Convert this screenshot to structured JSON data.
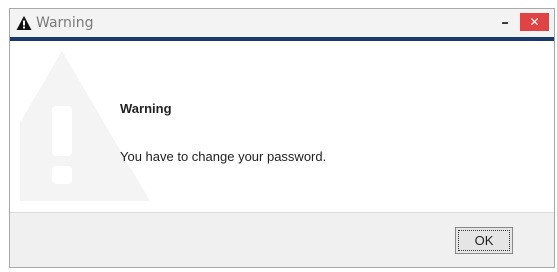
{
  "window": {
    "title": "Warning",
    "minimize_label": "–",
    "close_label": "✕"
  },
  "dialog": {
    "heading": "Warning",
    "message": "You have to change your password.",
    "icon": "warning-icon"
  },
  "footer": {
    "ok_label": "OK"
  },
  "colors": {
    "accent_bar": "#1a3a6b",
    "close_button": "#e04343"
  }
}
